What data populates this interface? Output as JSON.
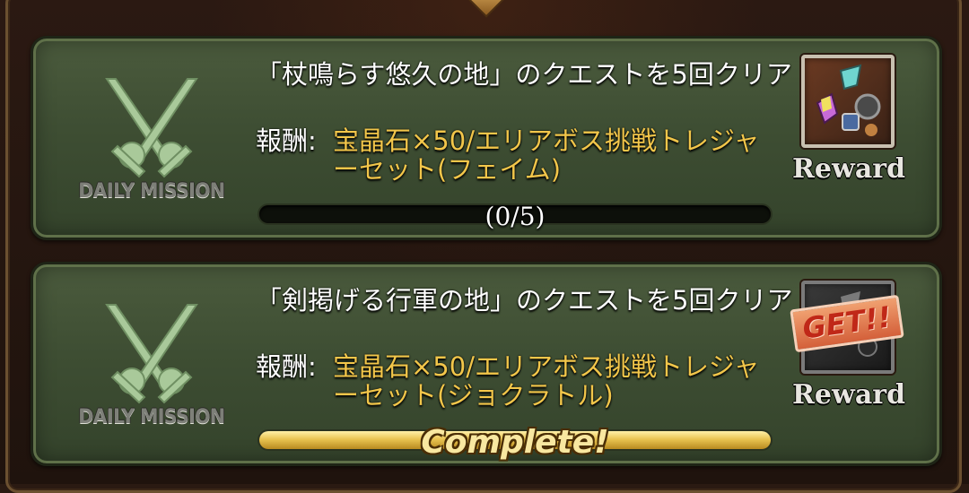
{
  "colors": {
    "card_bg": "#3e4e33",
    "reward_text": "#f2c64a",
    "progress_fill": "#e9c451",
    "get_stamp": "#d4603a"
  },
  "missions": [
    {
      "badge_label": "DAILY MISSION",
      "badge_icon": "crossed-swords-icon",
      "title": "「杖鳴らす悠久の地」のクエストを5回クリア",
      "reward_label": "報酬:",
      "reward_items": "宝晶石×50/エリアボス挑戦トレジャーセット(フェイム)",
      "progress_text": "(0/5)",
      "progress": 0,
      "reward_caption": "Reward",
      "reward_icon": "treasure-set-icon",
      "completed": false
    },
    {
      "badge_label": "DAILY MISSION",
      "badge_icon": "crossed-swords-icon",
      "title": "「剣掲げる行軍の地」のクエストを5回クリア",
      "reward_label": "報酬:",
      "reward_items": "宝晶石×50/エリアボス挑戦トレジャーセット(ジョクラトル)",
      "complete_text": "Complete!",
      "progress": 1,
      "reward_caption": "Reward",
      "get_text": "GET!!",
      "reward_icon": "treasure-set-icon",
      "completed": true
    }
  ]
}
